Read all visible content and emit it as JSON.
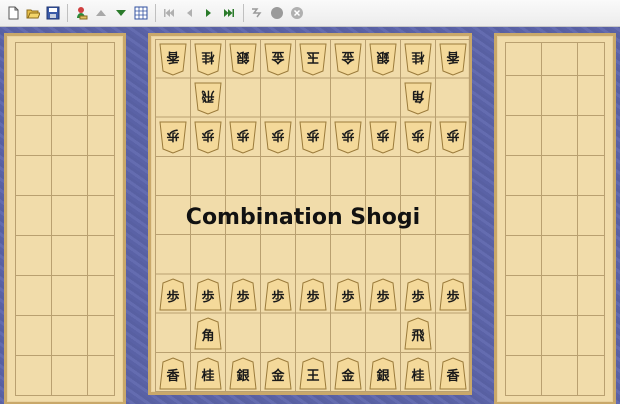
{
  "toolbar": {
    "buttons": [
      {
        "icon": "new-file-icon"
      },
      {
        "icon": "open-folder-icon"
      },
      {
        "icon": "save-icon"
      },
      {
        "icon": "editor-icon"
      },
      {
        "icon": "up-arrow-icon"
      },
      {
        "icon": "down-arrow-icon"
      },
      {
        "icon": "grid-icon"
      },
      {
        "icon": "first-move-icon"
      },
      {
        "icon": "previous-move-icon"
      },
      {
        "icon": "next-move-icon"
      },
      {
        "icon": "last-move-icon"
      },
      {
        "icon": "shuffle-icon"
      },
      {
        "icon": "stop-icon"
      },
      {
        "icon": "close-icon"
      }
    ]
  },
  "title": "Combination Shogi",
  "colors": {
    "board": "#f1dcaa",
    "board_border": "#c9a86a",
    "background": "#5c63a8",
    "piece_face": "#f4d99a",
    "piece_text": "#1a1a1a",
    "promoted_text": "#b01010"
  },
  "pieces": {
    "gote_back_row": [
      "香",
      "桂",
      "銀",
      "金",
      "玉",
      "金",
      "銀",
      "桂",
      "香"
    ],
    "gote_rook": "飛",
    "gote_bishop": "角",
    "gote_pawn": "歩",
    "sente_pawn": "歩",
    "sente_bishop": "角",
    "sente_rook": "飛",
    "sente_back_row": [
      "香",
      "桂",
      "銀",
      "金",
      "王",
      "金",
      "銀",
      "桂",
      "香"
    ]
  }
}
